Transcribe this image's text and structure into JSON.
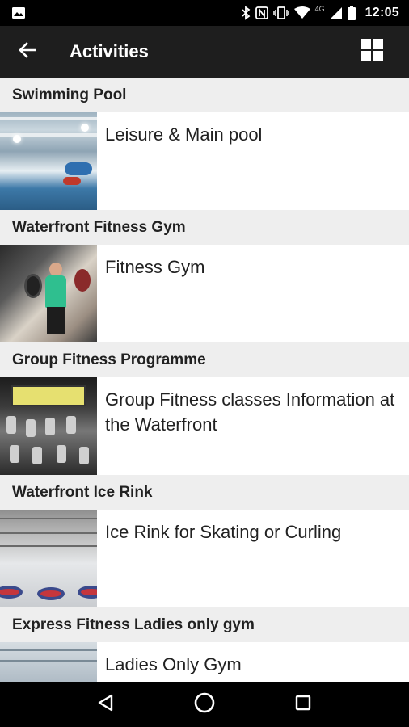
{
  "status_bar": {
    "time": "12:05",
    "network_label": "4G",
    "icons": [
      "image-icon",
      "bluetooth-icon",
      "nfc-icon",
      "vibrate-icon",
      "wifi-icon",
      "signal-icon",
      "battery-icon"
    ]
  },
  "app_bar": {
    "title": "Activities",
    "back_icon": "arrow-back-icon",
    "menu_icon": "grid-icon"
  },
  "sections": [
    {
      "header": "Swimming Pool",
      "item": "Leisure & Main pool",
      "thumbnail": "pool-photo"
    },
    {
      "header": "Waterfront Fitness Gym",
      "item": "Fitness Gym",
      "thumbnail": "gym-photo"
    },
    {
      "header": "Group Fitness Programme",
      "item": "Group Fitness classes Information at the Waterfront",
      "thumbnail": "fitness-class-photo"
    },
    {
      "header": "Waterfront Ice Rink",
      "item": "Ice Rink for Skating or Curling",
      "thumbnail": "ice-rink-photo"
    },
    {
      "header": "Express Fitness Ladies only gym",
      "item": "Ladies Only Gym",
      "thumbnail": "ladies-gym-photo"
    }
  ],
  "nav_bar": {
    "icons": [
      "back-triangle-icon",
      "home-circle-icon",
      "recents-square-icon"
    ]
  },
  "colors": {
    "status_bar": "#000000",
    "app_bar": "#1e1e1e",
    "section_header": "#eeeeee",
    "text": "#212121"
  }
}
